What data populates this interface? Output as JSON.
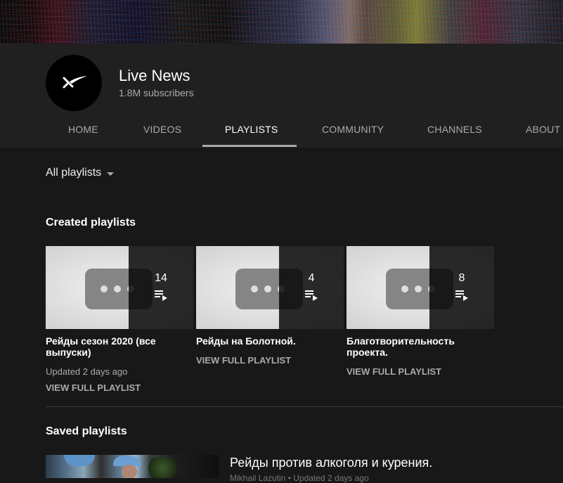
{
  "channel": {
    "name": "Live News",
    "subscribers": "1.8M subscribers"
  },
  "tabs": [
    {
      "label": "HOME"
    },
    {
      "label": "VIDEOS"
    },
    {
      "label": "PLAYLISTS",
      "active": true
    },
    {
      "label": "COMMUNITY"
    },
    {
      "label": "CHANNELS"
    },
    {
      "label": "ABOUT"
    }
  ],
  "sort": {
    "label": "All playlists"
  },
  "created": {
    "title": "Created playlists",
    "playlists": [
      {
        "count": "14",
        "title": "Рейды сезон 2020 (все выпуски)",
        "updated": "Updated 2 days ago",
        "view": "VIEW FULL PLAYLIST"
      },
      {
        "count": "4",
        "title": "Рейды на Болотной.",
        "view": "VIEW FULL PLAYLIST"
      },
      {
        "count": "8",
        "title": "Благотворительность проекта.",
        "view": "VIEW FULL PLAYLIST"
      }
    ]
  },
  "saved": {
    "title": "Saved playlists",
    "playlists": [
      {
        "title": "Рейды против алкоголя и курения.",
        "meta": "Mikhail Lazutin • Updated 2 days ago"
      }
    ]
  },
  "colors": {
    "background": "#181818",
    "header": "#202020",
    "text_secondary": "#aaaaaa"
  },
  "icons": [
    "channel-logo-icon",
    "dropdown-caret-icon",
    "playlist-icon"
  ]
}
